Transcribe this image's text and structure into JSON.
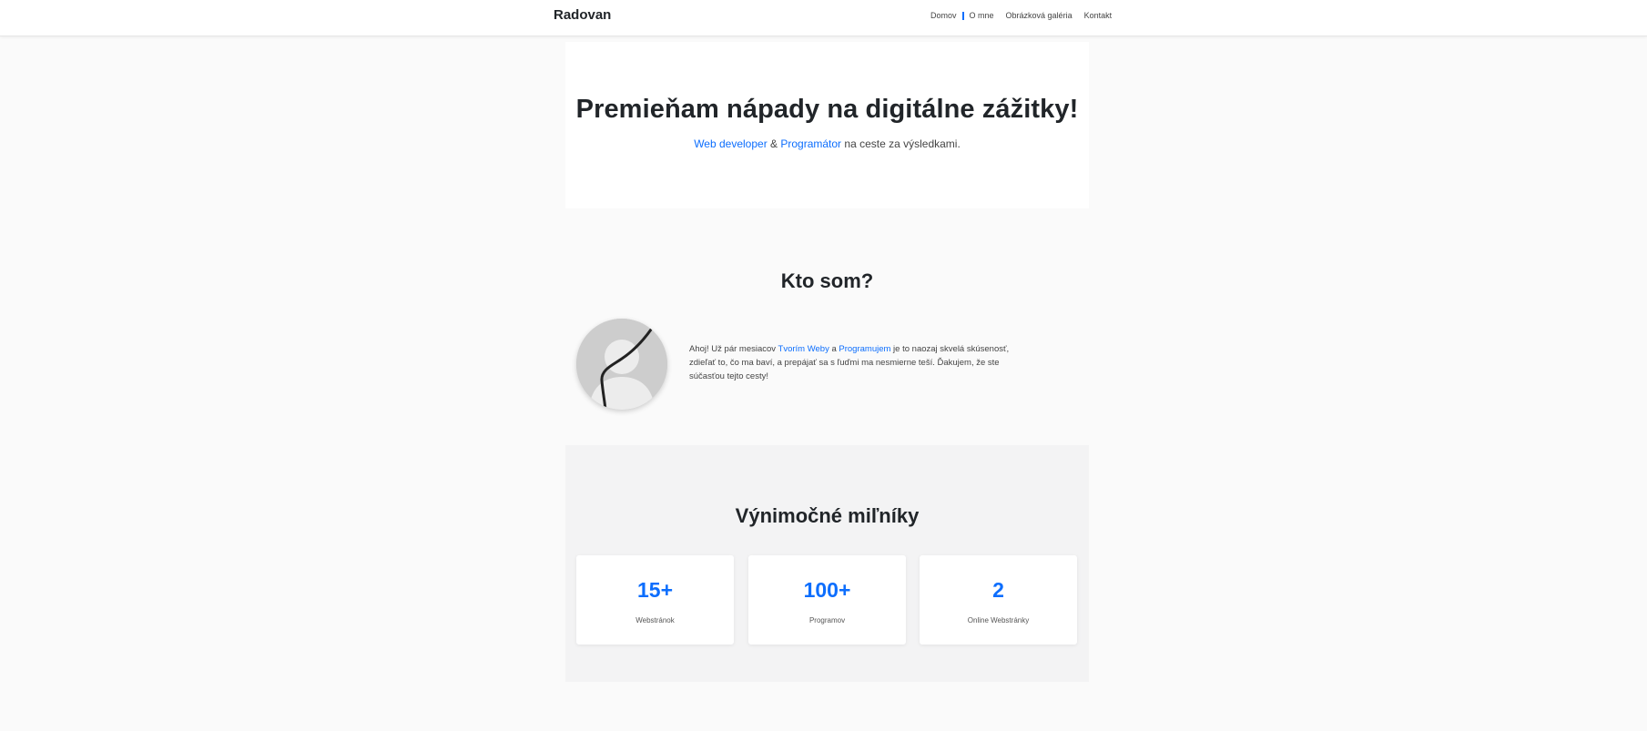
{
  "navbar": {
    "brand": "Radovan",
    "items": [
      {
        "label": "Domov"
      },
      {
        "label": "O mne"
      },
      {
        "label": "Obrázková galéria"
      },
      {
        "label": "Kontakt"
      }
    ]
  },
  "hero": {
    "title": "Premieňam nápady na digitálne zážitky!",
    "subtitle_link1": "Web developer",
    "subtitle_amp": " & ",
    "subtitle_link2": "Programátor",
    "subtitle_rest": " na ceste za výsledkami."
  },
  "about": {
    "heading": "Kto som?",
    "text_part1": "Ahoj! Už pár mesiacov ",
    "link1": "Tvorím Weby",
    "text_part2": " a ",
    "link2": "Programujem",
    "text_part3": " je to naozaj skvelá skúsenosť, zdieľať to, čo ma baví, a prepájať sa s ľuďmi ma nesmierne teší. Ďakujem, že ste súčasťou tejto cesty!"
  },
  "milestones": {
    "heading": "Výnimočné miľníky",
    "cards": [
      {
        "value": "15+",
        "label": "Webstránok"
      },
      {
        "value": "100+",
        "label": "Programov"
      },
      {
        "value": "2",
        "label": "Online Webstránky"
      }
    ]
  },
  "colors": {
    "accent": "#0d6efd",
    "background": "#fafafa",
    "section_alt": "#f3f3f4"
  }
}
